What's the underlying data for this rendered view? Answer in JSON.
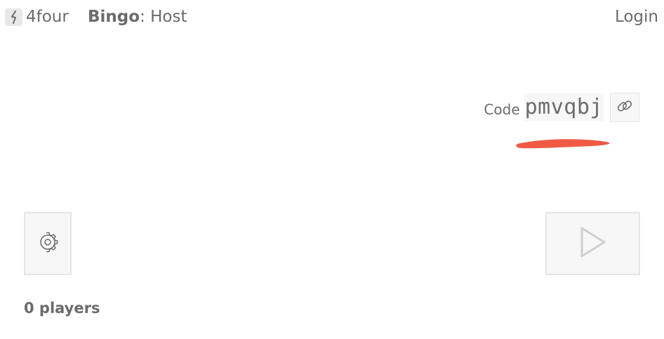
{
  "header": {
    "app_name": "4four",
    "title_strong": "Bingo",
    "title_rest": ": Host",
    "login_label": "Login"
  },
  "game": {
    "code_label": "Code",
    "code_value": "pmvqbj"
  },
  "players": {
    "count_text": "0 players"
  },
  "icons": {
    "logo": "4four-logo-icon",
    "link": "link-icon",
    "settings": "gear-icon",
    "play": "play-icon"
  },
  "colors": {
    "text": "#6b6b6b",
    "button_bg": "#f7f7f7",
    "button_border": "#e6e6e6",
    "annotation_red": "#f05a45"
  }
}
